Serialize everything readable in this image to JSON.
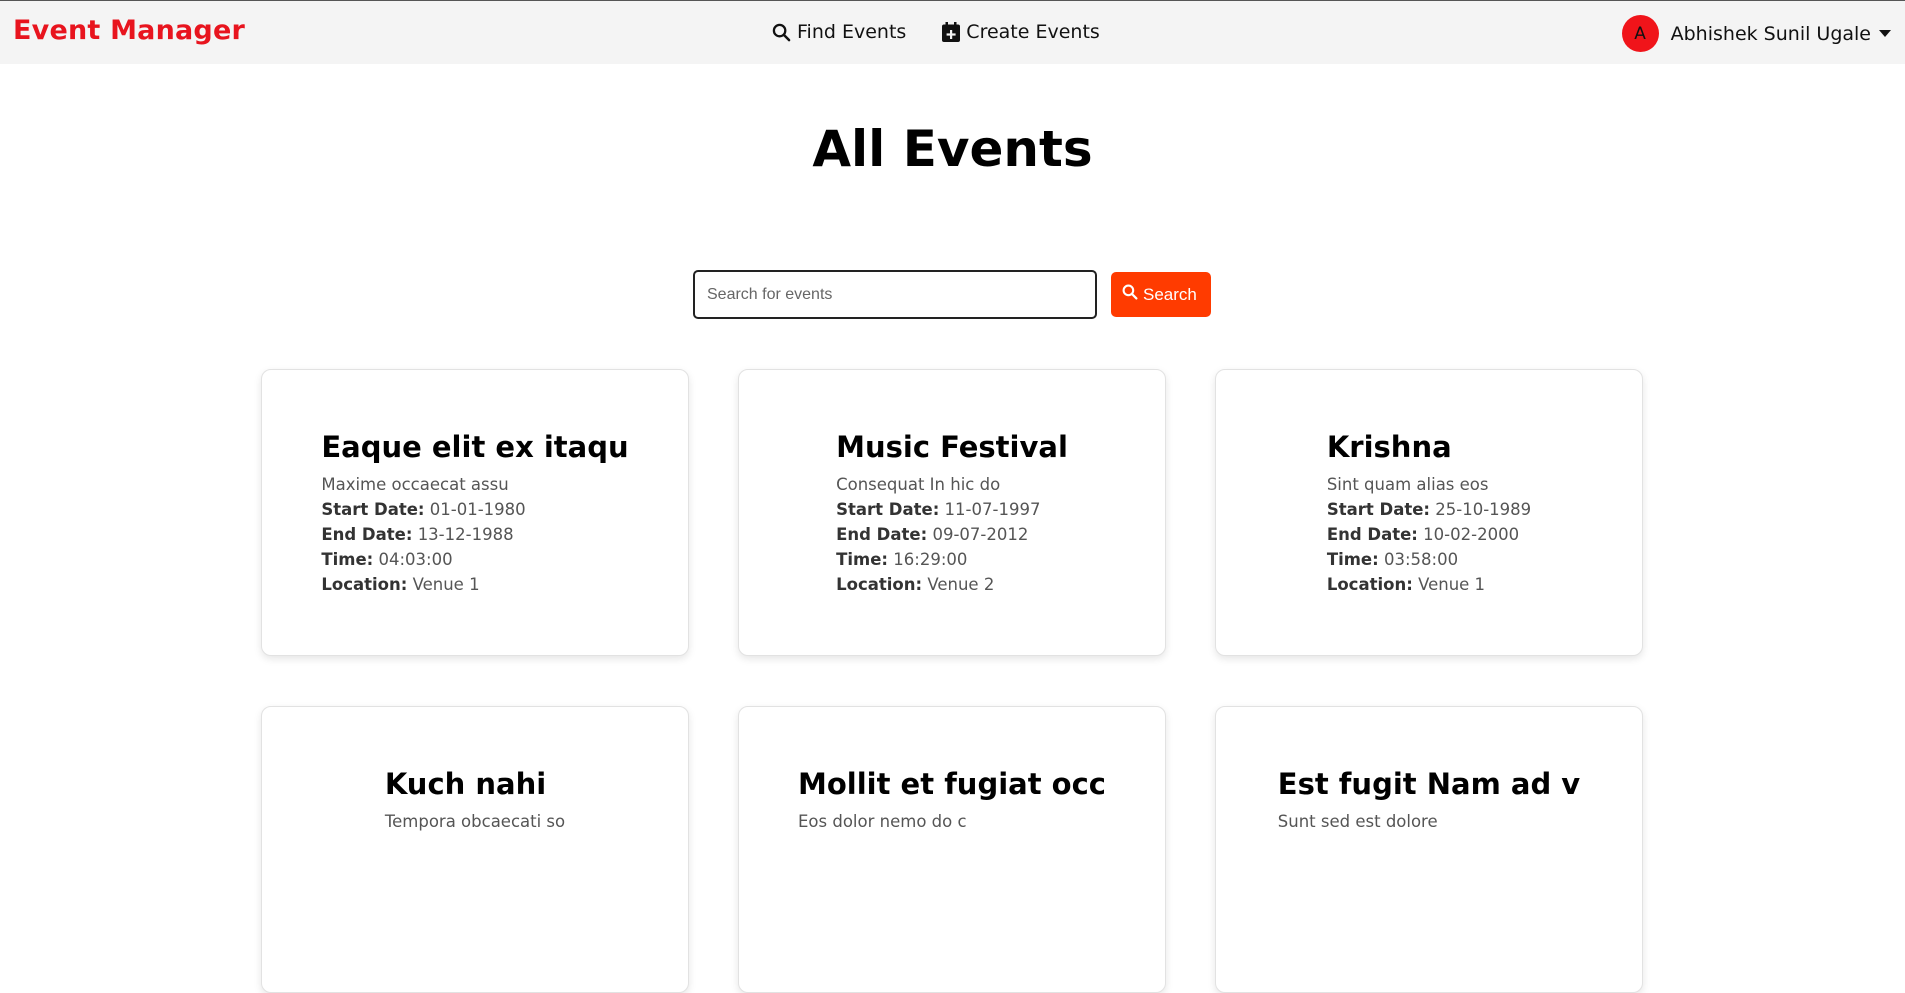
{
  "navbar": {
    "brand": "Event Manager",
    "links": [
      {
        "label": "Find Events",
        "icon": "search-icon"
      },
      {
        "label": "Create Events",
        "icon": "calendar-plus-icon"
      }
    ],
    "user": {
      "avatar_initial": "A",
      "name": "Abhishek Sunil Ugale",
      "avatar_color": "#f0141a"
    }
  },
  "page": {
    "title": "All Events"
  },
  "search": {
    "placeholder": "Search for events",
    "value": "",
    "button_label": "Search",
    "button_color": "#ff3b00"
  },
  "labels": {
    "start_date": "Start Date:",
    "end_date": "End Date:",
    "time": "Time:",
    "location": "Location:"
  },
  "events": [
    {
      "title": "Eaque elit ex itaqu",
      "description": "Maxime occaecat assu",
      "start_date": "01-01-1980",
      "end_date": "13-12-1988",
      "time": "04:03:00",
      "location": "Venue 1"
    },
    {
      "title": "Music Festival",
      "description": "Consequat In hic do",
      "start_date": "11-07-1997",
      "end_date": "09-07-2012",
      "time": "16:29:00",
      "location": "Venue 2"
    },
    {
      "title": "Krishna",
      "description": "Sint quam alias eos",
      "start_date": "25-10-1989",
      "end_date": "10-02-2000",
      "time": "03:58:00",
      "location": "Venue 1"
    },
    {
      "title": "Kuch nahi",
      "description": "Tempora obcaecati so",
      "start_date": "",
      "end_date": "",
      "time": "",
      "location": ""
    },
    {
      "title": "Mollit et fugiat occ",
      "description": "Eos dolor nemo do c",
      "start_date": "",
      "end_date": "",
      "time": "",
      "location": ""
    },
    {
      "title": "Est fugit Nam ad v",
      "description": "Sunt sed est dolore",
      "start_date": "",
      "end_date": "",
      "time": "",
      "location": ""
    }
  ]
}
